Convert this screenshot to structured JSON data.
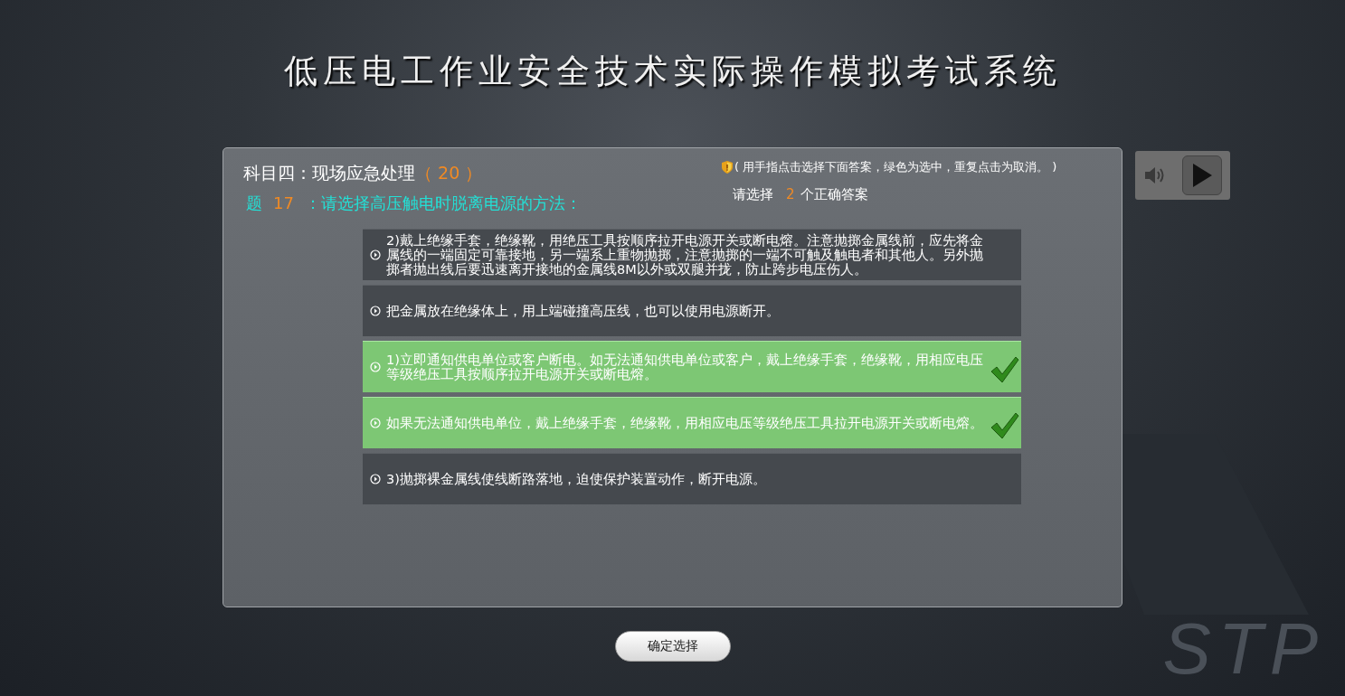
{
  "title": "低压电工作业安全技术实际操作模拟考试系统",
  "subject": {
    "label": "科目四：现场应急处理",
    "score_open": "（",
    "score": "20",
    "score_close": "）"
  },
  "question": {
    "prefix": "题",
    "number": "17",
    "text": "：请选择高压触电时脱离电源的方法："
  },
  "hint": "( 用手指点击选择下面答案，绿色为选中，重复点击为取消。 )",
  "instruction": {
    "before": "请选择",
    "count": "2",
    "after": "个正确答案"
  },
  "options": [
    {
      "text": "2)戴上绝缘手套，绝缘靴，用绝压工具按顺序拉开电源开关或断电熔。注意抛掷金属线前，应先将金属线的一端固定可靠接地，另一端系上重物抛掷，注意抛掷的一端不可触及触电者和其他人。另外抛掷者抛出线后要迅速离开接地的金属线8M以外或双腿并拢，防止跨步电压伤人。",
      "selected": false
    },
    {
      "text": "把金属放在绝缘体上，用上端碰撞高压线，也可以使用电源断开。",
      "selected": false
    },
    {
      "text": "1)立即通知供电单位或客户断电。如无法通知供电单位或客户，戴上绝缘手套，绝缘靴，用相应电压等级绝压工具按顺序拉开电源开关或断电熔。",
      "selected": true
    },
    {
      "text": "如果无法通知供电单位，戴上绝缘手套，绝缘靴，用相应电压等级绝压工具拉开电源开关或断电熔。",
      "selected": true
    },
    {
      "text": "3)抛掷裸金属线使线断路落地，迫使保护装置动作，断开电源。",
      "selected": false
    }
  ],
  "confirm_button": "确定选择",
  "background_mark": "STP"
}
